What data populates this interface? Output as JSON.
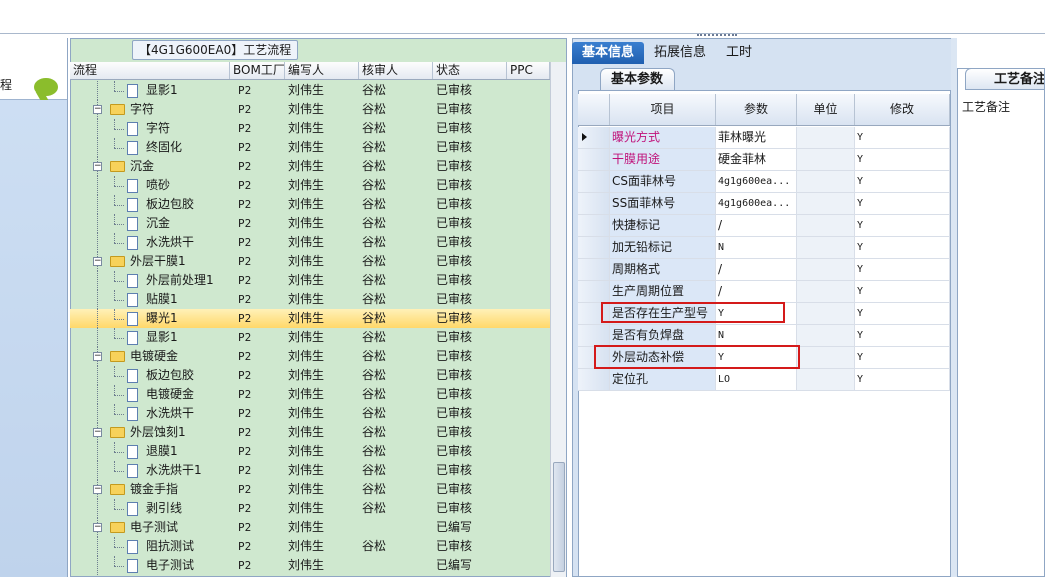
{
  "left_pane": {
    "label": "程"
  },
  "flow": {
    "title": "【4G1G600EA0】工艺流程",
    "columns": [
      "流程",
      "BOM工厂",
      "编写人",
      "核审人",
      "状态",
      "PPC"
    ],
    "rows": [
      {
        "name": "显影1",
        "level": 2,
        "type": "file",
        "bom": "P2",
        "editor": "刘伟生",
        "reviewer": "谷松",
        "status": "已审核"
      },
      {
        "name": "字符",
        "level": 1,
        "type": "folder",
        "bom": "P2",
        "editor": "刘伟生",
        "reviewer": "谷松",
        "status": "已审核"
      },
      {
        "name": "字符",
        "level": 2,
        "type": "file",
        "bom": "P2",
        "editor": "刘伟生",
        "reviewer": "谷松",
        "status": "已审核"
      },
      {
        "name": "终固化",
        "level": 2,
        "type": "file",
        "bom": "P2",
        "editor": "刘伟生",
        "reviewer": "谷松",
        "status": "已审核"
      },
      {
        "name": "沉金",
        "level": 1,
        "type": "folder",
        "bom": "P2",
        "editor": "刘伟生",
        "reviewer": "谷松",
        "status": "已审核"
      },
      {
        "name": "喷砂",
        "level": 2,
        "type": "file",
        "bom": "P2",
        "editor": "刘伟生",
        "reviewer": "谷松",
        "status": "已审核"
      },
      {
        "name": "板边包胶",
        "level": 2,
        "type": "file",
        "bom": "P2",
        "editor": "刘伟生",
        "reviewer": "谷松",
        "status": "已审核"
      },
      {
        "name": "沉金",
        "level": 2,
        "type": "file",
        "bom": "P2",
        "editor": "刘伟生",
        "reviewer": "谷松",
        "status": "已审核"
      },
      {
        "name": "水洗烘干",
        "level": 2,
        "type": "file",
        "bom": "P2",
        "editor": "刘伟生",
        "reviewer": "谷松",
        "status": "已审核"
      },
      {
        "name": "外层干膜1",
        "level": 1,
        "type": "folder",
        "bom": "P2",
        "editor": "刘伟生",
        "reviewer": "谷松",
        "status": "已审核"
      },
      {
        "name": "外层前处理1",
        "level": 2,
        "type": "file",
        "bom": "P2",
        "editor": "刘伟生",
        "reviewer": "谷松",
        "status": "已审核"
      },
      {
        "name": "贴膜1",
        "level": 2,
        "type": "file",
        "bom": "P2",
        "editor": "刘伟生",
        "reviewer": "谷松",
        "status": "已审核"
      },
      {
        "name": "曝光1",
        "level": 2,
        "type": "file",
        "bom": "P2",
        "editor": "刘伟生",
        "reviewer": "谷松",
        "status": "已审核",
        "selected": true
      },
      {
        "name": "显影1",
        "level": 2,
        "type": "file",
        "bom": "P2",
        "editor": "刘伟生",
        "reviewer": "谷松",
        "status": "已审核"
      },
      {
        "name": "电镀硬金",
        "level": 1,
        "type": "folder",
        "bom": "P2",
        "editor": "刘伟生",
        "reviewer": "谷松",
        "status": "已审核"
      },
      {
        "name": "板边包胶",
        "level": 2,
        "type": "file",
        "bom": "P2",
        "editor": "刘伟生",
        "reviewer": "谷松",
        "status": "已审核"
      },
      {
        "name": "电镀硬金",
        "level": 2,
        "type": "file",
        "bom": "P2",
        "editor": "刘伟生",
        "reviewer": "谷松",
        "status": "已审核"
      },
      {
        "name": "水洗烘干",
        "level": 2,
        "type": "file",
        "bom": "P2",
        "editor": "刘伟生",
        "reviewer": "谷松",
        "status": "已审核"
      },
      {
        "name": "外层蚀刻1",
        "level": 1,
        "type": "folder",
        "bom": "P2",
        "editor": "刘伟生",
        "reviewer": "谷松",
        "status": "已审核"
      },
      {
        "name": "退膜1",
        "level": 2,
        "type": "file",
        "bom": "P2",
        "editor": "刘伟生",
        "reviewer": "谷松",
        "status": "已审核"
      },
      {
        "name": "水洗烘干1",
        "level": 2,
        "type": "file",
        "bom": "P2",
        "editor": "刘伟生",
        "reviewer": "谷松",
        "status": "已审核"
      },
      {
        "name": "镀金手指",
        "level": 1,
        "type": "folder",
        "bom": "P2",
        "editor": "刘伟生",
        "reviewer": "谷松",
        "status": "已审核"
      },
      {
        "name": "剥引线",
        "level": 2,
        "type": "file",
        "bom": "P2",
        "editor": "刘伟生",
        "reviewer": "谷松",
        "status": "已审核"
      },
      {
        "name": "电子测试",
        "level": 1,
        "type": "folder",
        "bom": "P2",
        "editor": "刘伟生",
        "reviewer": "",
        "status": "已编写"
      },
      {
        "name": "阻抗测试",
        "level": 2,
        "type": "file",
        "bom": "P2",
        "editor": "刘伟生",
        "reviewer": "谷松",
        "status": "已审核"
      },
      {
        "name": "电子测试",
        "level": 2,
        "type": "file",
        "bom": "P2",
        "editor": "刘伟生",
        "reviewer": "",
        "status": "已编写"
      }
    ]
  },
  "right": {
    "tabs": [
      "基本信息",
      "拓展信息",
      "工时"
    ],
    "active_tab": "基本信息",
    "subtab": "基本参数",
    "columns": [
      "项目",
      "参数",
      "单位",
      "修改"
    ],
    "rows": [
      {
        "item": "曝光方式",
        "param": "菲林曝光",
        "unit": "",
        "mod": "Y",
        "pink": true,
        "current": true
      },
      {
        "item": "干膜用途",
        "param": "硬金菲林",
        "unit": "",
        "mod": "Y",
        "pink": true
      },
      {
        "item": "CS面菲林号",
        "param": "4g1g600ea...",
        "unit": "",
        "mod": "Y",
        "mono": true
      },
      {
        "item": "SS面菲林号",
        "param": "4g1g600ea...",
        "unit": "",
        "mod": "Y",
        "mono": true
      },
      {
        "item": "快捷标记",
        "param": "/",
        "unit": "",
        "mod": "Y"
      },
      {
        "item": "加无铅标记",
        "param": "N",
        "unit": "",
        "mod": "Y",
        "mono": true
      },
      {
        "item": "周期格式",
        "param": "/",
        "unit": "",
        "mod": "Y"
      },
      {
        "item": "生产周期位置",
        "param": "/",
        "unit": "",
        "mod": "Y"
      },
      {
        "item": "是否存在生产型号",
        "param": "Y",
        "unit": "",
        "mod": "Y",
        "mono": true
      },
      {
        "item": "是否有负焊盘",
        "param": "N",
        "unit": "",
        "mod": "Y",
        "mono": true
      },
      {
        "item": "外层动态补偿",
        "param": "Y",
        "unit": "",
        "mod": "Y",
        "mono": true
      },
      {
        "item": "定位孔",
        "param": "LO",
        "unit": "",
        "mod": "Y",
        "mono": true
      }
    ]
  },
  "far_right": {
    "tab": "工艺备注",
    "label": "工艺备注"
  },
  "colors": {
    "tree_bg": "#cfe8cf",
    "highlight": "#d41a1a",
    "selected_row": "#ffd86a",
    "tab_active": "#1f5fb0",
    "pink_text": "#c0127a"
  }
}
